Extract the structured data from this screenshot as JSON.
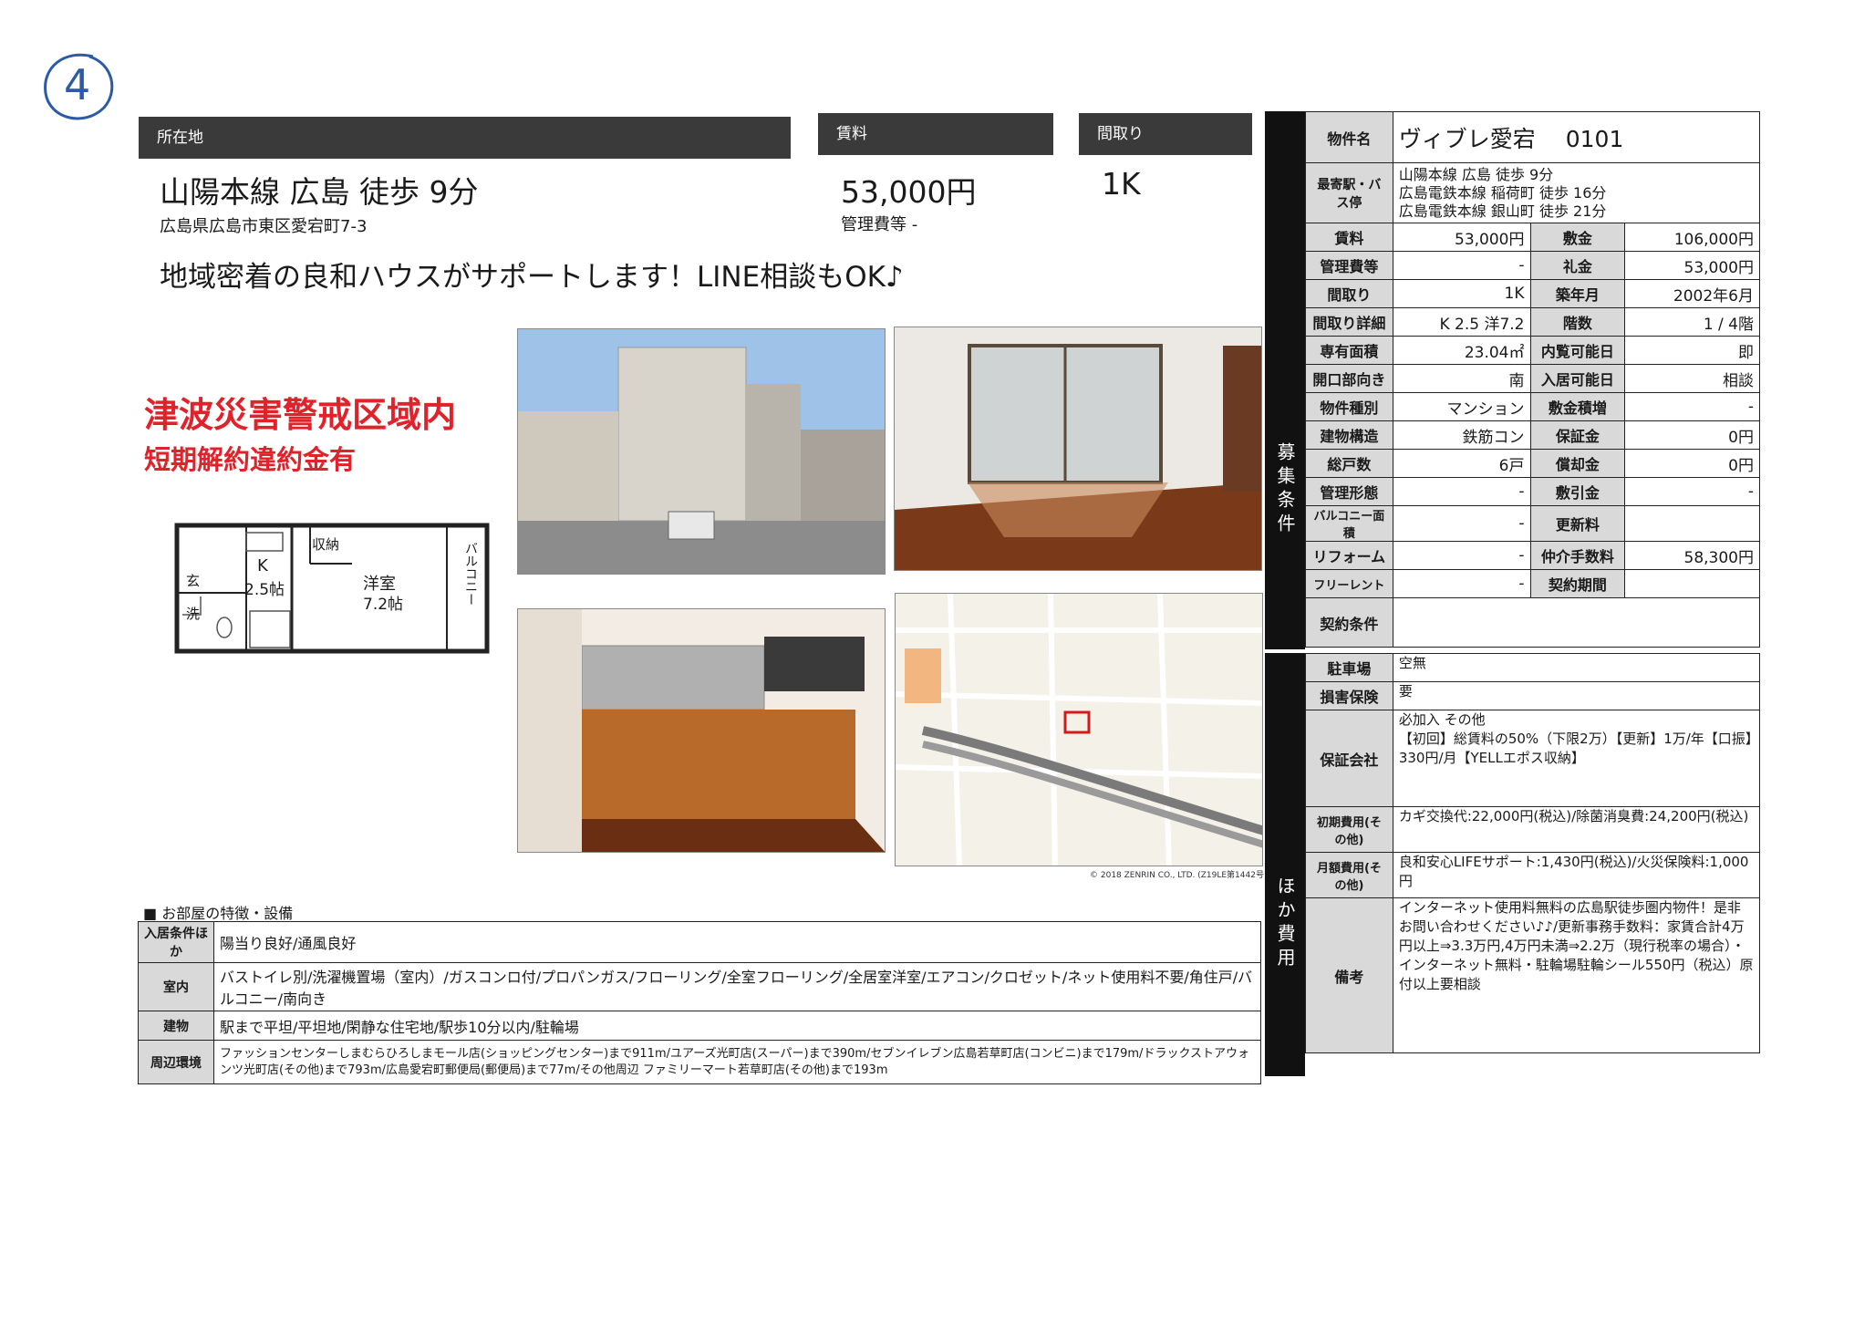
{
  "handwritten_number": "4",
  "headers": {
    "location": "所在地",
    "rent": "賃料",
    "layout": "間取り"
  },
  "summary": {
    "route": "山陽本線 広島 徒歩 9分",
    "address": "広島県広島市東区愛宕町7-3",
    "rent": "53,000円",
    "management_fee": "管理費等 -",
    "layout": "1K"
  },
  "catchcopy": "地域密着の良和ハウスがサポートします！LINE相談もOK♪",
  "stamp": {
    "line1": "津波災害警戒区域内",
    "line2": "短期解約違約金有"
  },
  "floorplan": {
    "genkan": "玄",
    "sen": "洗",
    "kitchen": "K",
    "kitchen_size": "2.5帖",
    "storage": "収納",
    "room": "洋室",
    "room_size": "7.2帖",
    "balcony": "バルコニー"
  },
  "map_credit": "© 2018 ZENRIN CO., LTD. (Z19LE第1442号)",
  "features": {
    "title": "■ お部屋の特徴・設備",
    "rows": [
      {
        "label": "入居条件ほか",
        "value": "陽当り良好/通風良好"
      },
      {
        "label": "室内",
        "value": "バストイレ別/洗濯機置場（室内）/ガスコンロ付/プロパンガス/フローリング/全室フローリング/全居室洋室/エアコン/クロゼット/ネット使用料不要/角住戸/バルコニー/南向き"
      },
      {
        "label": "建物",
        "value": "駅まで平坦/平坦地/閑静な住宅地/駅歩10分以内/駐輪場"
      },
      {
        "label": "周辺環境",
        "value": "ファッションセンターしまむらひろしまモール店(ショッピングセンター)まで911m/ユアーズ光町店(スーパー)まで390m/セブンイレブン広島若草町店(コンビニ)まで179m/ドラックストアウォンツ光町店(その他)まで793m/広島愛宕町郵便局(郵便局)まで77m/その他周辺 ファミリーマート若草町店(その他)まで193m"
      }
    ]
  },
  "side_labels": {
    "boshu": "募集条件",
    "hoka": "ほか費用"
  },
  "conditions": {
    "name_label": "物件名",
    "name_value": "ヴィブレ愛宕　 0101",
    "station_label": "最寄駅・バス停",
    "stations": [
      "山陽本線 広島 徒歩 9分",
      "広島電鉄本線 稲荷町 徒歩 16分",
      "広島電鉄本線 銀山町 徒歩 21分"
    ],
    "pairs": [
      [
        "賃料",
        "53,000円",
        "敷金",
        "106,000円"
      ],
      [
        "管理費等",
        "-",
        "礼金",
        "53,000円"
      ],
      [
        "間取り",
        "1K",
        "築年月",
        "2002年6月"
      ],
      [
        "間取り詳細",
        "K 2.5 洋7.2",
        "階数",
        "1 / 4階"
      ],
      [
        "専有面積",
        "23.04㎡",
        "内覧可能日",
        "即"
      ],
      [
        "開口部向き",
        "南",
        "入居可能日",
        "相談"
      ],
      [
        "物件種別",
        "マンション",
        "敷金積増",
        "-"
      ],
      [
        "建物構造",
        "鉄筋コン",
        "保証金",
        "0円"
      ],
      [
        "総戸数",
        "6戸",
        "償却金",
        "0円"
      ],
      [
        "管理形態",
        "-",
        "敷引金",
        "-"
      ],
      [
        "バルコニー面積",
        "-",
        "更新料",
        ""
      ],
      [
        "リフォーム",
        "-",
        "仲介手数料",
        "58,300円"
      ],
      [
        "フリーレント",
        "-",
        "契約期間",
        ""
      ]
    ],
    "contract_label": "契約条件",
    "contract_value": ""
  },
  "costs": [
    {
      "label": "駐車場",
      "value": "空無"
    },
    {
      "label": "損害保険",
      "value": "要"
    },
    {
      "label": "保証会社",
      "value": "必加入 その他\n【初回】総賃料の50%（下限2万）【更新】1万/年【口振】330円/月【YELLエポス収納】"
    },
    {
      "label": "初期費用(その他)",
      "value": "カギ交換代:22,000円(税込)/除菌消臭費:24,200円(税込)"
    },
    {
      "label": "月額費用(その他)",
      "value": "良和安心LIFEサポート:1,430円(税込)/火災保険料:1,000円"
    },
    {
      "label": "備考",
      "value": "インターネット使用料無料の広島駅徒歩圏内物件！是非お問い合わせください♪♪/更新事務手数料：家賃合計4万円以上⇒3.3万円,4万円未満⇒2.2万（現行税率の場合）・インターネット無料・駐輪場駐輪シール550円（税込）原付以上要相談"
    }
  ],
  "colors": {
    "header_bar": "#3a3a3a",
    "label_bg": "#d9d9d9",
    "stamp_red": "#e0222a",
    "pen_blue": "#2a5aa8"
  }
}
